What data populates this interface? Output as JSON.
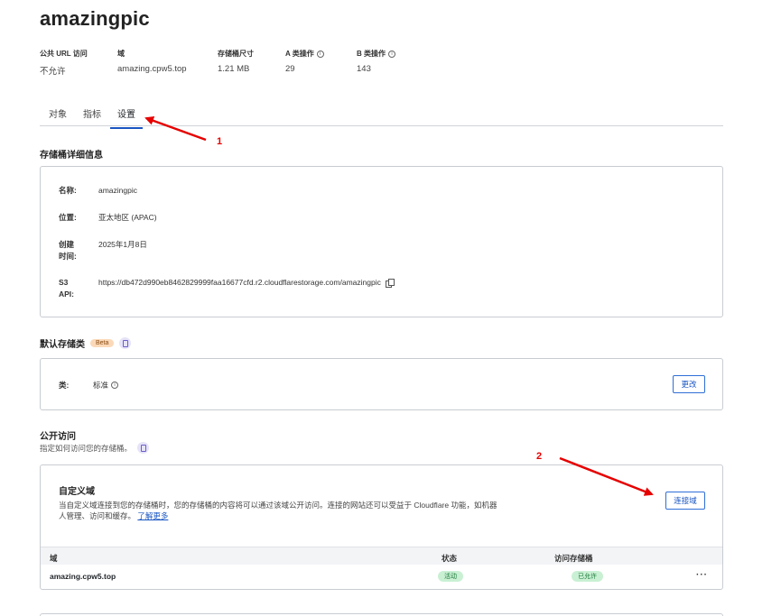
{
  "bucket": {
    "name": "amazingpic"
  },
  "stats": [
    {
      "label": "公共 URL 访问",
      "value": "不允许",
      "info": false
    },
    {
      "label": "域",
      "value": "amazing.cpw5.top",
      "info": false
    },
    {
      "label": "存储桶尺寸",
      "value": "1.21 MB",
      "info": false
    },
    {
      "label": "A 类操作",
      "value": "29",
      "info": true
    },
    {
      "label": "B 类操作",
      "value": "143",
      "info": true
    }
  ],
  "tabs": [
    {
      "label": "对象",
      "active": false
    },
    {
      "label": "指标",
      "active": false
    },
    {
      "label": "设置",
      "active": true
    }
  ],
  "details": {
    "title": "存储桶详细信息",
    "rows": [
      {
        "key": "名称:",
        "value": "amazingpic",
        "copy": false
      },
      {
        "key": "位置:",
        "value": "亚太地区 (APAC)",
        "copy": false
      },
      {
        "key": "创建时间:",
        "value": "2025年1月8日",
        "copy": false
      },
      {
        "key": "S3 API:",
        "value": "https://db472d990eb8462829999faa16677cfd.r2.cloudflarestorage.com/amazingpic",
        "copy": true
      }
    ]
  },
  "storage_class": {
    "title": "默认存储类",
    "badge": "Beta",
    "key": "类:",
    "value": "标准",
    "button": "更改"
  },
  "public_access": {
    "title": "公开访问",
    "subtitle": "指定如何访问您的存储桶。"
  },
  "custom_domain": {
    "title": "自定义域",
    "description": "当自定义域连接到您的存储桶时，您的存储桶的内容将可以通过该域公开访问。连接的网站还可以受益于 Cloudflare 功能，如机器人管理、访问和缓存。",
    "learn_more": "了解更多",
    "button": "连接域",
    "table": {
      "headers": [
        "域",
        "状态",
        "访问存储桶"
      ],
      "rows": [
        {
          "domain": "amazing.cpw5.top",
          "status": "活动",
          "access": "已允许"
        }
      ]
    }
  },
  "annotations": [
    "1",
    "2"
  ],
  "colors": {
    "accent": "#1a56c2",
    "arrow": "#e60000",
    "pill_bg": "#c9f0d3",
    "beta_bg": "#fbd9b8"
  },
  "icons": [
    "info-icon",
    "copy-icon",
    "doc-icon",
    "more-icon"
  ]
}
